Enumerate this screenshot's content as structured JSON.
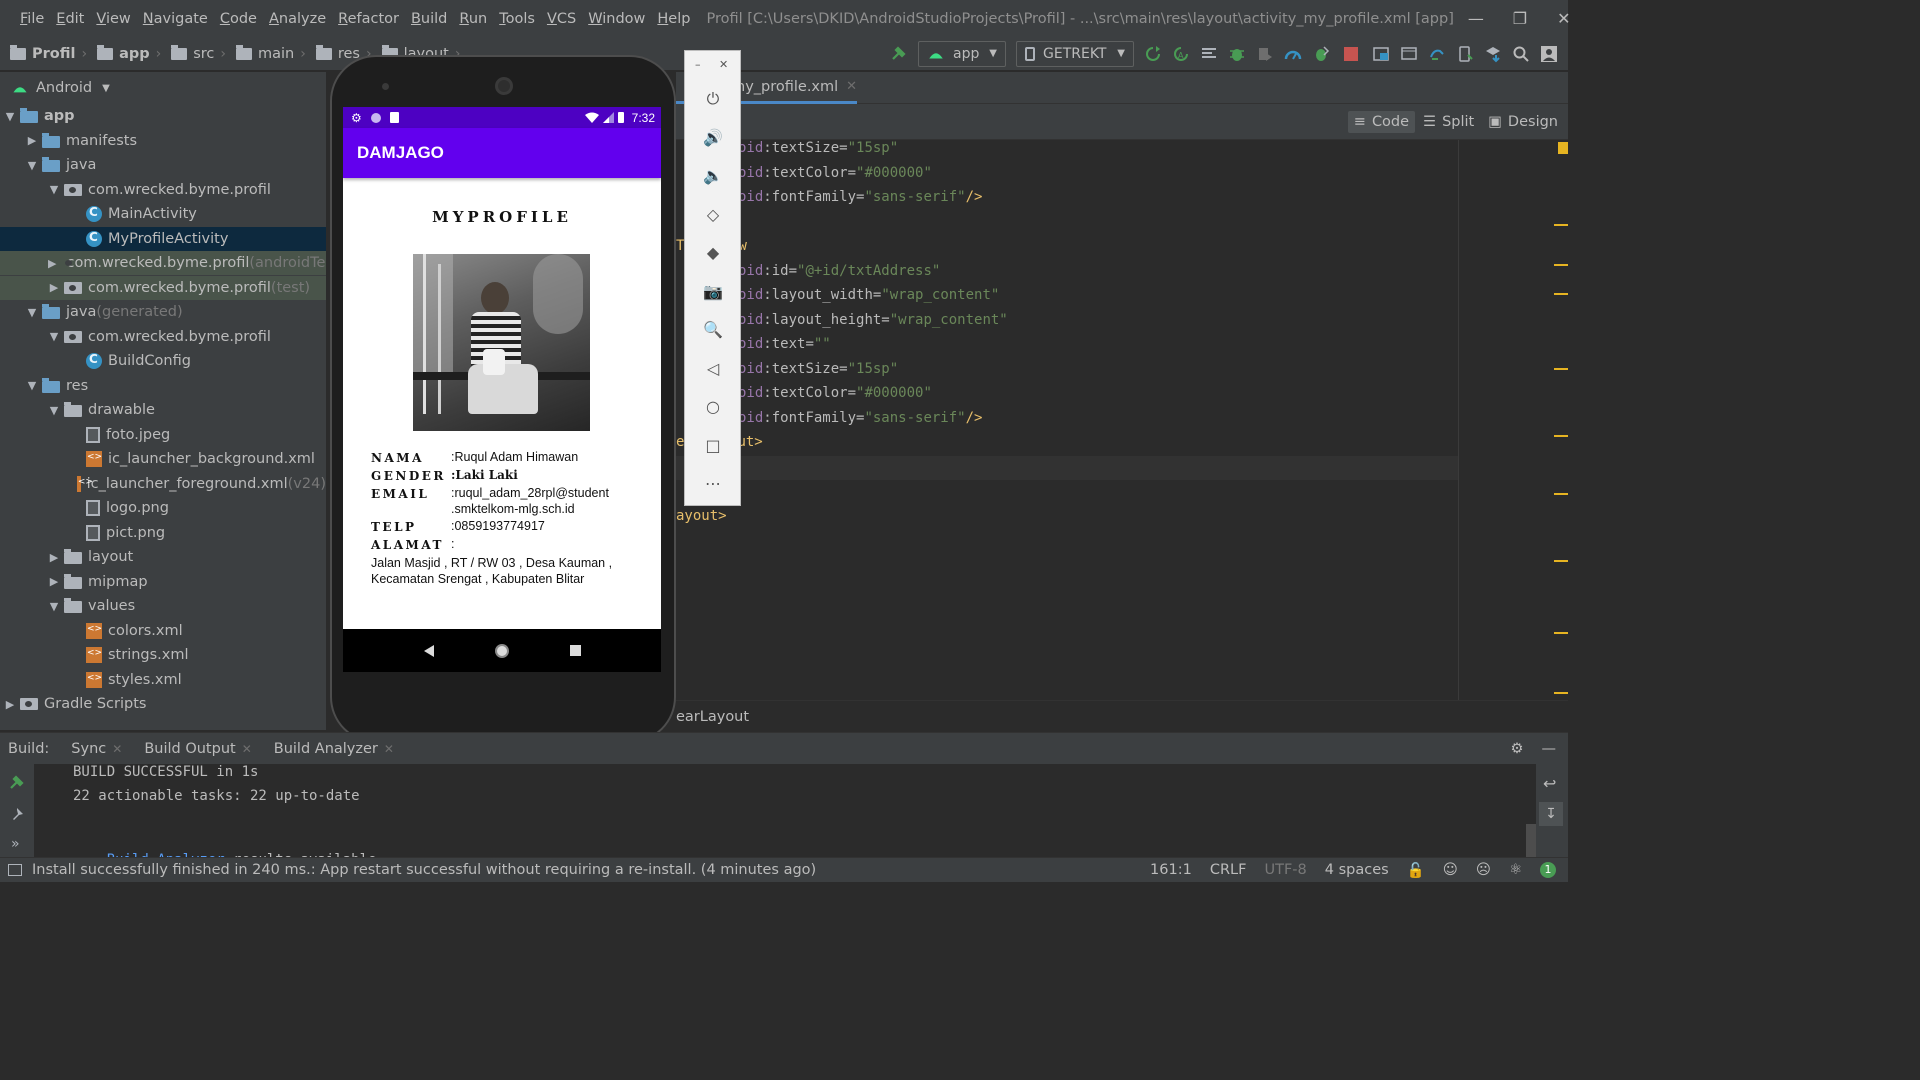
{
  "window": {
    "menu": [
      "File",
      "Edit",
      "View",
      "Navigate",
      "Code",
      "Analyze",
      "Refactor",
      "Build",
      "Run",
      "Tools",
      "VCS",
      "Window",
      "Help"
    ],
    "title": "Profil [C:\\Users\\DKID\\AndroidStudioProjects\\Profil] - ...\\src\\main\\res\\layout\\activity_my_profile.xml [app]"
  },
  "navbar": {
    "breadcrumbs": [
      "Profil",
      "app",
      "src",
      "main",
      "res",
      "layout"
    ],
    "run_config": "app",
    "device": "GETREKT"
  },
  "project": {
    "view_mode": "Android",
    "tree": [
      {
        "label": "app",
        "suffix": "",
        "depth": 0,
        "open": true,
        "icon": "folder-blue-icon",
        "bold": true
      },
      {
        "label": "manifests",
        "suffix": "",
        "depth": 1,
        "open": false,
        "icon": "folder-blue-icon"
      },
      {
        "label": "java",
        "suffix": "",
        "depth": 1,
        "open": true,
        "icon": "folder-blue-icon"
      },
      {
        "label": "com.wrecked.byme.profil",
        "suffix": "",
        "depth": 2,
        "open": true,
        "icon": "package-icon"
      },
      {
        "label": "MainActivity",
        "suffix": "",
        "depth": 3,
        "open": null,
        "icon": "activity-class-icon"
      },
      {
        "label": "MyProfileActivity",
        "suffix": "",
        "depth": 3,
        "open": null,
        "icon": "activity-class-icon",
        "selected": true
      },
      {
        "label": "com.wrecked.byme.profil",
        "suffix": " (androidTest)",
        "depth": 2,
        "open": false,
        "icon": "package-icon",
        "test": true
      },
      {
        "label": "com.wrecked.byme.profil",
        "suffix": " (test)",
        "depth": 2,
        "open": false,
        "icon": "package-icon",
        "test": true
      },
      {
        "label": "java",
        "suffix": " (generated)",
        "depth": 1,
        "open": true,
        "icon": "folder-generated-icon"
      },
      {
        "label": "com.wrecked.byme.profil",
        "suffix": "",
        "depth": 2,
        "open": true,
        "icon": "package-icon"
      },
      {
        "label": "BuildConfig",
        "suffix": "",
        "depth": 3,
        "open": null,
        "icon": "class-icon"
      },
      {
        "label": "res",
        "suffix": "",
        "depth": 1,
        "open": true,
        "icon": "folder-res-icon"
      },
      {
        "label": "drawable",
        "suffix": "",
        "depth": 2,
        "open": true,
        "icon": "folder-icon"
      },
      {
        "label": "foto.jpeg",
        "suffix": "",
        "depth": 3,
        "open": null,
        "icon": "image-file-icon"
      },
      {
        "label": "ic_launcher_background.xml",
        "suffix": "",
        "depth": 3,
        "open": null,
        "icon": "xml-file-icon"
      },
      {
        "label": "ic_launcher_foreground.xml",
        "suffix": " (v24)",
        "depth": 3,
        "open": null,
        "icon": "xml-file-icon"
      },
      {
        "label": "logo.png",
        "suffix": "",
        "depth": 3,
        "open": null,
        "icon": "image-file-icon"
      },
      {
        "label": "pict.png",
        "suffix": "",
        "depth": 3,
        "open": null,
        "icon": "image-file-icon"
      },
      {
        "label": "layout",
        "suffix": "",
        "depth": 2,
        "open": false,
        "icon": "folder-icon"
      },
      {
        "label": "mipmap",
        "suffix": "",
        "depth": 2,
        "open": false,
        "icon": "folder-icon"
      },
      {
        "label": "values",
        "suffix": "",
        "depth": 2,
        "open": true,
        "icon": "folder-icon"
      },
      {
        "label": "colors.xml",
        "suffix": "",
        "depth": 3,
        "open": null,
        "icon": "xml-file-icon"
      },
      {
        "label": "strings.xml",
        "suffix": "",
        "depth": 3,
        "open": null,
        "icon": "xml-file-icon"
      },
      {
        "label": "styles.xml",
        "suffix": "",
        "depth": 3,
        "open": null,
        "icon": "xml-file-icon"
      },
      {
        "label": "Gradle Scripts",
        "suffix": "",
        "depth": 0,
        "open": false,
        "icon": "gradle-icon"
      }
    ]
  },
  "phone": {
    "status_time": "7:32",
    "app_title": "DAMJAGO",
    "profile_title": "MYPROFILE",
    "fields": [
      {
        "label": "NAMA",
        "value": ":Ruqul Adam Himawan"
      },
      {
        "label": "GENDER",
        "value": ":Laki Laki"
      },
      {
        "label": "EMAIL",
        "value": ":ruqul_adam_28rpl@student",
        "value2": " .smktelkom-mlg.sch.id"
      },
      {
        "label": "TELP",
        "value": ":0859193774917"
      },
      {
        "label": "ALAMAT",
        "value": ":"
      }
    ],
    "address_line1": "Jalan Masjid , RT / RW 03 , Desa Kauman ,",
    "address_line2": "Kecamatan Srengat , Kabupaten Blitar"
  },
  "emulator_tools": [
    "power-icon",
    "volume-up-icon",
    "volume-down-icon",
    "rotate-left-icon",
    "rotate-right-icon",
    "camera-icon",
    "zoom-icon",
    "back-icon",
    "home-icon",
    "overview-icon",
    "more-icon"
  ],
  "editor": {
    "tab": "activity_my_profile.xml",
    "tab_visible": "ny_profile.xml",
    "modes": [
      "Code",
      "Split",
      "Design"
    ],
    "lines": [
      {
        "ns": "oid",
        "attr": ":textSize=",
        "val": "\"15sp\""
      },
      {
        "ns": "oid",
        "attr": ":textColor=",
        "val": "\"#000000\""
      },
      {
        "ns": "oid",
        "attr": ":fontFamily=",
        "val": "\"sans-serif\"",
        "end": "/>"
      },
      {
        "ns": "",
        "attr": "",
        "val": ""
      },
      {
        "ns": "",
        "attr": "",
        "val": "",
        "frag": "w"
      },
      {
        "ns": "oid",
        "attr": ":id=",
        "val": "\"@+id/txtAddress\""
      },
      {
        "ns": "oid",
        "attr": ":layout_width=",
        "val": "\"wrap_content\""
      },
      {
        "ns": "oid",
        "attr": ":layout_height=",
        "val": "\"wrap_content\""
      },
      {
        "ns": "oid",
        "attr": ":text=",
        "val": "\"\""
      },
      {
        "ns": "oid",
        "attr": ":textSize=",
        "val": "\"15sp\""
      },
      {
        "ns": "oid",
        "attr": ":textColor=",
        "val": "\"#000000\""
      },
      {
        "ns": "oid",
        "attr": ":fontFamily=",
        "val": "\"sans-serif\"",
        "end": "/>"
      },
      {
        "ns": "",
        "attr": "",
        "val": "",
        "tag": "e",
        "tagend": "ut>"
      },
      {
        "ns": "",
        "attr": "",
        "val": ""
      },
      {
        "ns": "",
        "attr": "",
        "val": ""
      },
      {
        "ns": "",
        "attr": "",
        "val": "",
        "tag": "ayout>"
      }
    ],
    "gutter_marker": "T",
    "breadcrumb": "earLayout"
  },
  "build": {
    "label": "Build:",
    "tabs": [
      "Sync",
      "Build Output",
      "Build Analyzer"
    ],
    "line1": "BUILD SUCCESSFUL in 1s",
    "line2": "22 actionable tasks: 22 up-to-date",
    "link": "Build Analyzer",
    "link_rest": " results available"
  },
  "status": {
    "message": "Install successfully finished in 240 ms.: App restart successful without requiring a re-install. (4 minutes ago)",
    "position": "161:1",
    "line_sep": "CRLF",
    "encoding": "UTF-8",
    "indent": "4 spaces",
    "notifications": "1"
  },
  "colors": {
    "accent_purple": "#6200ee",
    "status_purple": "#4d01c2",
    "selection": "#0d293e",
    "build_success": "#499c54"
  }
}
